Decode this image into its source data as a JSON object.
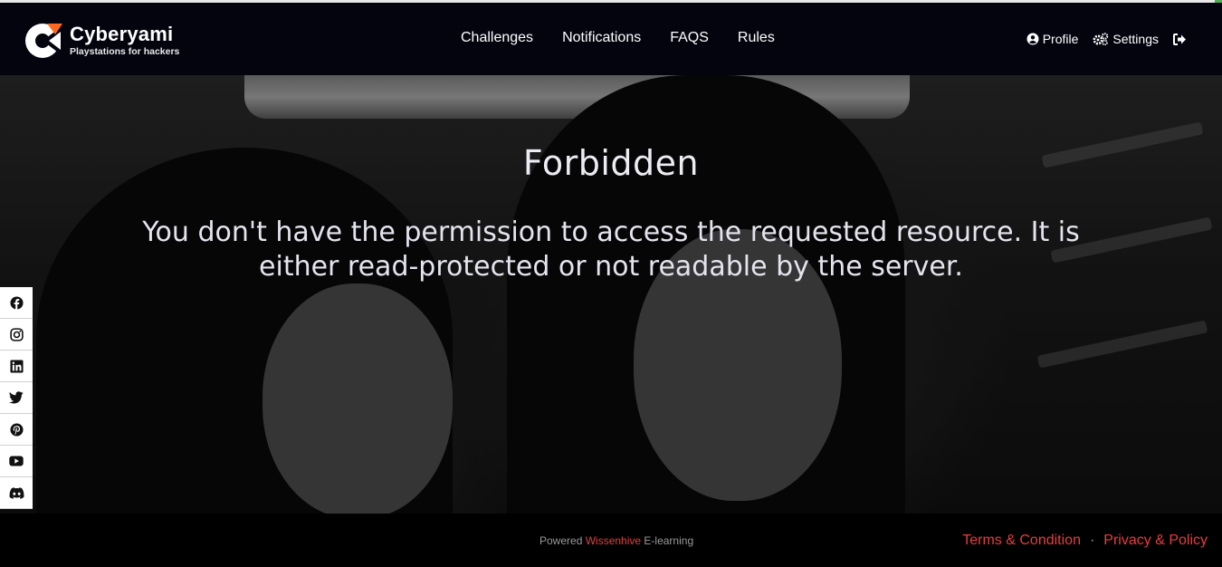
{
  "header": {
    "brand": "Cyberyami",
    "tagline": "Playstations for hackers",
    "nav": [
      {
        "label": "Challenges"
      },
      {
        "label": "Notifications"
      },
      {
        "label": "FAQS"
      },
      {
        "label": "Rules"
      }
    ],
    "user_nav": {
      "profile_label": "Profile",
      "settings_label": "Settings"
    }
  },
  "main": {
    "title": "Forbidden",
    "message": "You don't have the permission to access the requested resource. It is either read-protected or not readable by the server."
  },
  "social": [
    {
      "icon": "facebook-icon"
    },
    {
      "icon": "instagram-icon"
    },
    {
      "icon": "linkedin-icon"
    },
    {
      "icon": "twitter-icon"
    },
    {
      "icon": "pinterest-icon"
    },
    {
      "icon": "youtube-icon"
    },
    {
      "icon": "discord-icon"
    }
  ],
  "footer": {
    "powered_prefix": "Powered",
    "powered_brand": "Wissenhive",
    "powered_suffix": "E-learning",
    "separator": "·",
    "terms_label": "Terms & Condition",
    "privacy_label": "Privacy & Policy"
  },
  "colors": {
    "header_bg": "#04040f",
    "accent": "#e53e3e",
    "text_light": "#ececf3"
  }
}
